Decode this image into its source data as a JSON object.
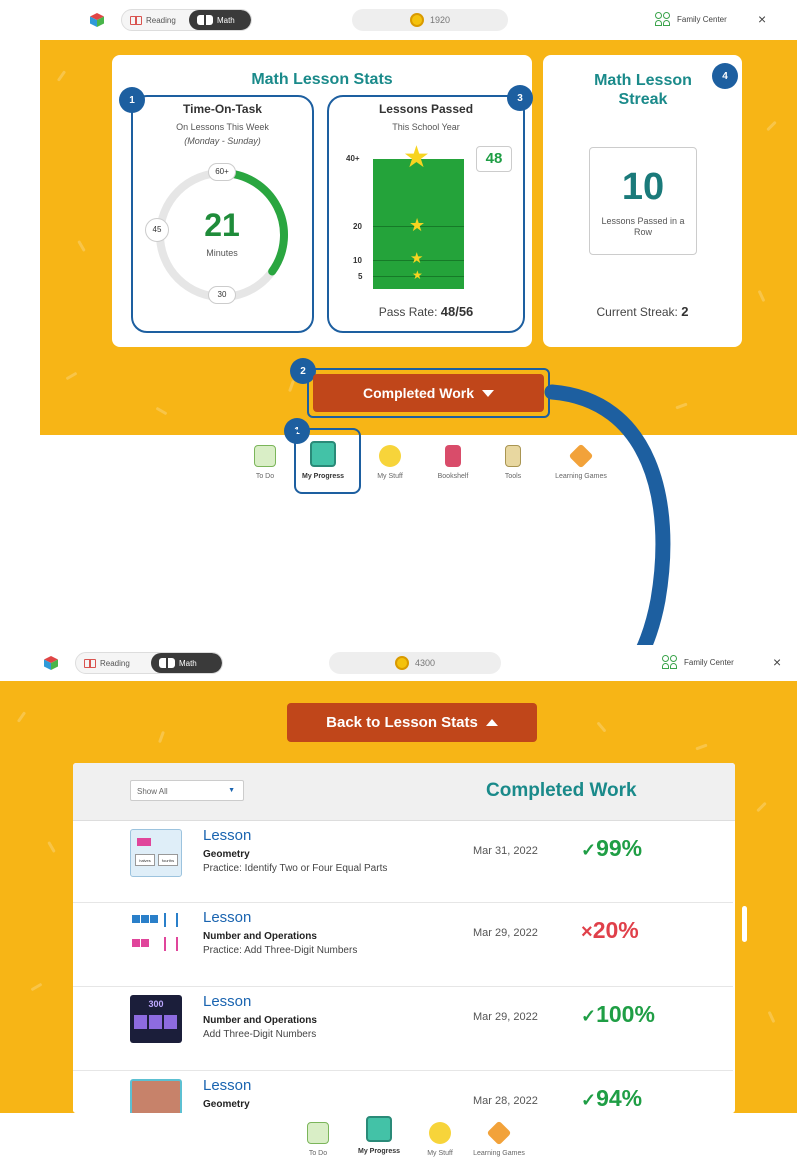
{
  "top_panel": {
    "header": {
      "subject_reading": "Reading",
      "subject_math": "Math",
      "coins": "1920",
      "family_center": "Family Center",
      "close": "×"
    },
    "stats_title": "Math Lesson Stats",
    "time_on_task": {
      "title": "Time-On-Task",
      "subtitle": "On Lessons This Week",
      "range": "(Monday - Sunday)",
      "value": "21",
      "unit": "Minutes",
      "dial_top": "60+",
      "dial_left": "45",
      "dial_bottom": "30",
      "progress_fraction": 0.35
    },
    "lessons_passed": {
      "title": "Lessons Passed",
      "subtitle": "This School Year",
      "value": "48",
      "labels": [
        "40+",
        "20",
        "10",
        "5"
      ],
      "pass_rate_label": "Pass Rate:",
      "pass_rate": "48/56"
    },
    "streak": {
      "title": "Math Lesson Streak",
      "value": "10",
      "caption": "Lessons Passed in a Row",
      "current_label": "Current Streak:",
      "current_value": "2"
    },
    "badges": [
      "1",
      "2",
      "3",
      "4"
    ],
    "completed_work_button": "Completed Work",
    "nav": [
      "To Do",
      "My Progress",
      "My Stuff",
      "Bookshelf",
      "Tools",
      "Learning Games"
    ]
  },
  "bottom_panel": {
    "header": {
      "subject_reading": "Reading",
      "subject_math": "Math",
      "coins": "4300",
      "family_center": "Family Center",
      "close": "×"
    },
    "back_button": "Back to Lesson Stats",
    "filter": "Show All",
    "table_title": "Completed Work",
    "rows": [
      {
        "title": "Lesson",
        "subject": "Geometry",
        "detail": "Practice: Identify Two or Four Equal Parts",
        "date": "Mar 31, 2022",
        "mark": "✓",
        "score": "99%",
        "status": "pass"
      },
      {
        "title": "Lesson",
        "subject": "Number and Operations",
        "detail": "Practice: Add Three-Digit Numbers",
        "date": "Mar 29, 2022",
        "mark": "×",
        "score": "20%",
        "status": "fail"
      },
      {
        "title": "Lesson",
        "subject": "Number and Operations",
        "detail": "Add Three-Digit Numbers",
        "date": "Mar 29, 2022",
        "mark": "✓",
        "score": "100%",
        "status": "pass"
      },
      {
        "title": "Lesson",
        "subject": "Geometry",
        "detail": "",
        "date": "Mar 28, 2022",
        "mark": "✓",
        "score": "94%",
        "status": "pass"
      }
    ],
    "thumb1_labels": [
      "halves",
      "fourths"
    ],
    "thumb3_label": "300",
    "nav": [
      "To Do",
      "My Progress",
      "My Stuff",
      "Learning Games"
    ]
  },
  "colors": {
    "yellow": "#f7b516",
    "teal": "#1a8a8a",
    "annotation_blue": "#1d5fa0",
    "button_red": "#c0461a",
    "pass_green": "#1f9e45",
    "fail_red": "#e0404a"
  }
}
